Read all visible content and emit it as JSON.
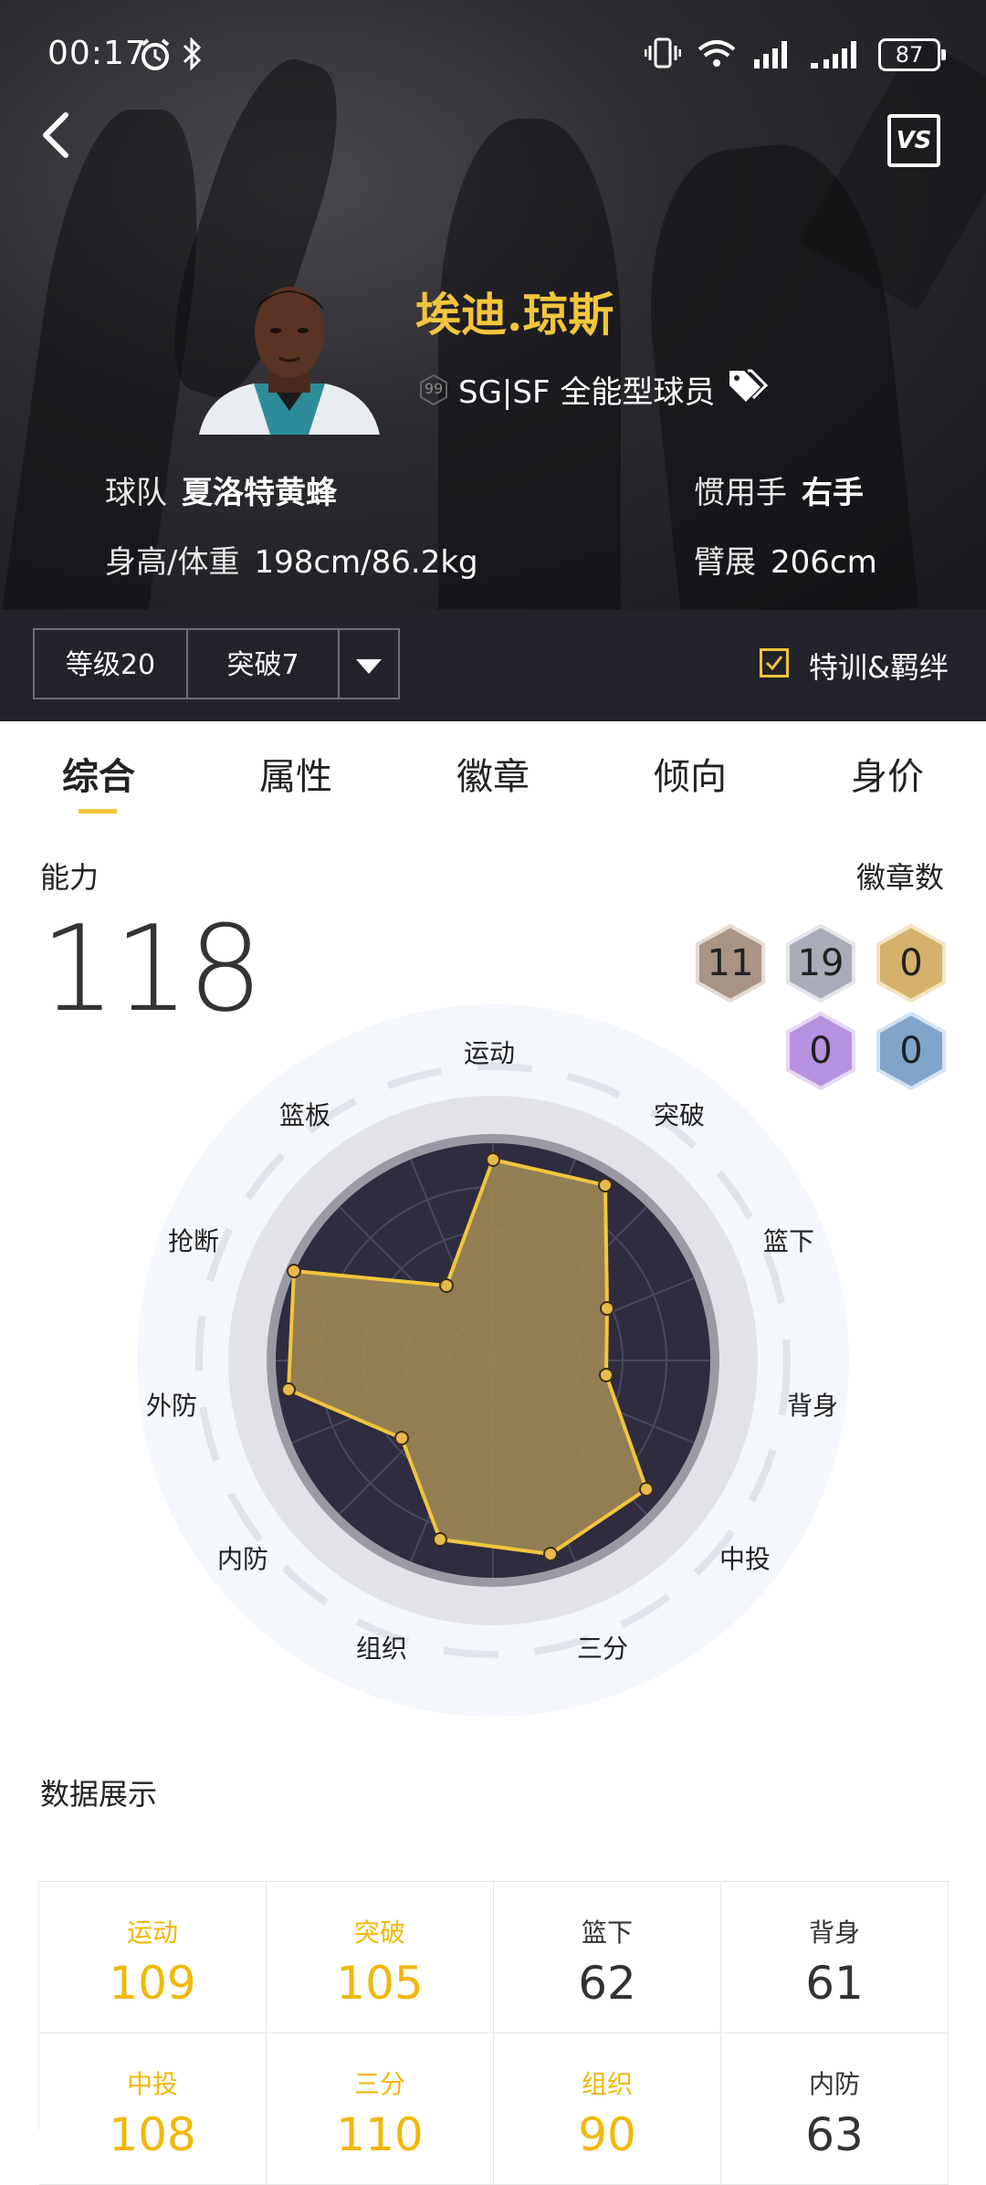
{
  "status": {
    "time": "00:17",
    "battery": "87"
  },
  "header": {
    "vs_label": "VS"
  },
  "player": {
    "name": "埃迪.琼斯",
    "rating_badge": "99",
    "position": "SG|SF 全能型球员",
    "team_key": "球队",
    "team": "夏洛特黄蜂",
    "hand_key": "惯用手",
    "hand": "右手",
    "hw_key": "身高/体重",
    "hw": "198cm/86.2kg",
    "wing_key": "臂展",
    "wing": "206cm"
  },
  "filters": {
    "level": "等级20",
    "breakthrough": "突破7",
    "special": "特训&羁绊"
  },
  "tabs": [
    "综合",
    "属性",
    "徽章",
    "倾向",
    "身价"
  ],
  "ability": {
    "label": "能力",
    "value": "118"
  },
  "badges": {
    "label": "徽章数",
    "bronze": "11",
    "silver": "19",
    "gold": "0",
    "purple": "0",
    "blue": "0"
  },
  "radar_labels": [
    "运动",
    "突破",
    "篮下",
    "背身",
    "中投",
    "三分",
    "组织",
    "内防",
    "外防",
    "抢断",
    "篮板"
  ],
  "section_title": "数据展示",
  "stats": [
    {
      "label": "运动",
      "value": "109"
    },
    {
      "label": "突破",
      "value": "105"
    },
    {
      "label": "篮下",
      "value": "62"
    },
    {
      "label": "背身",
      "value": "61"
    },
    {
      "label": "中投",
      "value": "108"
    },
    {
      "label": "三分",
      "value": "110"
    },
    {
      "label": "组织",
      "value": "90"
    },
    {
      "label": "内防",
      "value": "63"
    }
  ],
  "colors": {
    "accent": "#f2c53d",
    "gold_text": "#f2b707",
    "dark_bar": "#23232b",
    "radar_fill": "#9c8655"
  }
}
